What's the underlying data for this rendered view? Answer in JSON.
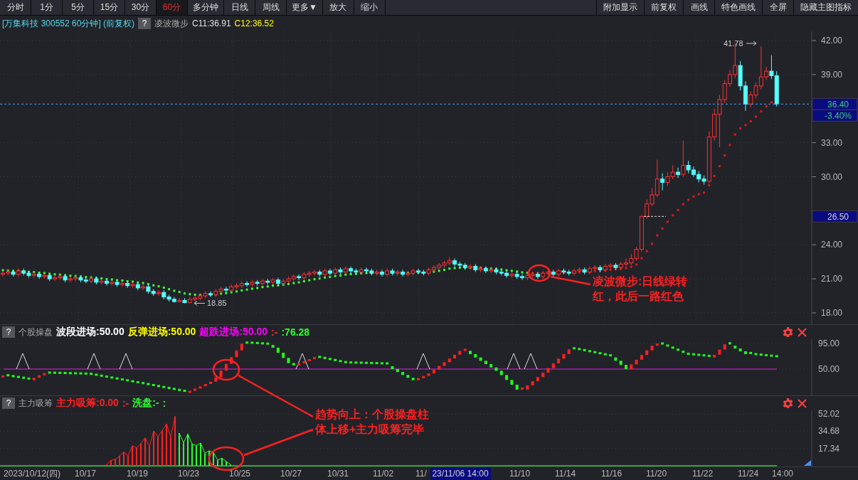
{
  "toolbar": {
    "left": [
      {
        "label": "分时",
        "selected": false
      },
      {
        "label": "1分",
        "selected": false
      },
      {
        "label": "5分",
        "selected": false
      },
      {
        "label": "15分",
        "selected": false
      },
      {
        "label": "30分",
        "selected": false
      },
      {
        "label": "60分",
        "selected": true
      },
      {
        "label": "多分钟",
        "selected": false
      },
      {
        "label": "日线",
        "selected": false
      },
      {
        "label": "周线",
        "selected": false
      },
      {
        "label": "更多▼",
        "selected": false
      },
      {
        "label": "放大",
        "selected": false
      },
      {
        "label": "缩小",
        "selected": false
      }
    ],
    "right": [
      "附加显示",
      "前复权",
      "画线",
      "特色画线",
      "全屏",
      "隐藏主图指标"
    ]
  },
  "info": {
    "title": "[万集科技 300552 60分钟] (前复权)",
    "help": "?",
    "indicator": "凌波微步",
    "values": [
      {
        "text": "C11:36.91",
        "color": "#e0e0e0"
      },
      {
        "text": "C12:36.52",
        "color": "#ffff00"
      }
    ]
  },
  "main_chart": {
    "chart_data": {
      "type": "candlestick",
      "ylim": [
        18,
        42
      ],
      "grid": true,
      "yticks": [
        {
          "value": 42,
          "label": "42.00"
        },
        {
          "value": 39,
          "label": "39.00"
        },
        {
          "value": 33,
          "label": "33.00"
        },
        {
          "value": 30,
          "label": "30.00"
        },
        {
          "value": 24,
          "label": "24.00"
        },
        {
          "value": 21,
          "label": "21.00"
        },
        {
          "value": 18,
          "label": "18.00"
        }
      ],
      "ohlc": [
        [
          21.4,
          21.7,
          21.2,
          21.5
        ],
        [
          21.5,
          21.8,
          21.3,
          21.6
        ],
        [
          21.6,
          21.8,
          21.2,
          21.4
        ],
        [
          21.4,
          21.9,
          21.2,
          21.7
        ],
        [
          21.7,
          21.9,
          21.3,
          21.5
        ],
        [
          21.5,
          21.7,
          21.1,
          21.3
        ],
        [
          21.3,
          21.6,
          21.1,
          21.4
        ],
        [
          21.4,
          21.6,
          21.0,
          21.2
        ],
        [
          21.2,
          21.5,
          21.0,
          21.3
        ],
        [
          21.3,
          21.5,
          20.8,
          21.0
        ],
        [
          21.0,
          21.3,
          20.8,
          21.1
        ],
        [
          21.1,
          21.4,
          20.9,
          21.2
        ],
        [
          21.2,
          21.4,
          20.7,
          20.9
        ],
        [
          20.9,
          21.2,
          20.7,
          21.0
        ],
        [
          21.0,
          21.3,
          20.8,
          21.1
        ],
        [
          21.1,
          21.3,
          20.7,
          20.9
        ],
        [
          20.9,
          21.1,
          20.6,
          20.8
        ],
        [
          20.8,
          21.2,
          20.6,
          21.0
        ],
        [
          21.0,
          21.2,
          20.5,
          20.7
        ],
        [
          20.7,
          21.0,
          20.5,
          20.8
        ],
        [
          20.8,
          21.0,
          20.4,
          20.6
        ],
        [
          20.6,
          20.9,
          20.4,
          20.7
        ],
        [
          20.7,
          20.9,
          20.3,
          20.5
        ],
        [
          20.5,
          20.8,
          20.3,
          20.6
        ],
        [
          20.6,
          20.8,
          20.2,
          20.4
        ],
        [
          20.4,
          20.7,
          20.2,
          20.5
        ],
        [
          20.5,
          20.7,
          20.0,
          20.2
        ],
        [
          20.2,
          20.5,
          20.0,
          20.3
        ],
        [
          20.3,
          20.5,
          19.7,
          19.9
        ],
        [
          19.9,
          20.1,
          19.5,
          19.7
        ],
        [
          19.7,
          20.0,
          19.5,
          19.8
        ],
        [
          19.8,
          20.0,
          19.2,
          19.4
        ],
        [
          19.4,
          19.6,
          19.0,
          19.2
        ],
        [
          19.2,
          19.4,
          18.9,
          19.0
        ],
        [
          19.0,
          19.3,
          18.9,
          19.1
        ],
        [
          19.1,
          19.3,
          18.85,
          18.9
        ],
        [
          18.9,
          19.4,
          18.9,
          19.2
        ],
        [
          19.2,
          19.5,
          19.0,
          19.3
        ],
        [
          19.3,
          19.7,
          19.1,
          19.5
        ],
        [
          19.5,
          19.9,
          19.3,
          19.7
        ],
        [
          19.7,
          19.9,
          19.4,
          19.6
        ],
        [
          19.6,
          20.1,
          19.4,
          19.9
        ],
        [
          19.9,
          20.3,
          19.7,
          20.1
        ],
        [
          20.1,
          20.3,
          19.8,
          20.0
        ],
        [
          20.0,
          20.5,
          19.8,
          20.3
        ],
        [
          20.3,
          20.6,
          20.1,
          20.4
        ],
        [
          20.4,
          20.8,
          20.2,
          20.6
        ],
        [
          20.6,
          20.8,
          20.3,
          20.5
        ],
        [
          20.5,
          20.9,
          20.3,
          20.7
        ],
        [
          20.7,
          20.9,
          20.4,
          20.6
        ],
        [
          20.6,
          21.0,
          20.4,
          20.8
        ],
        [
          20.8,
          21.0,
          20.5,
          20.7
        ],
        [
          20.7,
          21.1,
          20.5,
          20.9
        ],
        [
          20.9,
          21.1,
          20.4,
          20.6
        ],
        [
          20.6,
          21.0,
          20.4,
          20.8
        ],
        [
          20.8,
          21.2,
          20.6,
          21.0
        ],
        [
          21.0,
          21.4,
          20.8,
          21.2
        ],
        [
          21.2,
          21.4,
          20.9,
          21.1
        ],
        [
          21.1,
          21.6,
          20.9,
          21.4
        ],
        [
          21.4,
          21.7,
          21.2,
          21.5
        ],
        [
          21.5,
          21.8,
          21.3,
          21.6
        ],
        [
          21.6,
          21.8,
          21.2,
          21.4
        ],
        [
          21.4,
          21.9,
          21.2,
          21.7
        ],
        [
          21.7,
          21.9,
          21.3,
          21.5
        ],
        [
          21.5,
          22.0,
          21.3,
          21.8
        ],
        [
          21.8,
          22.0,
          21.4,
          21.6
        ],
        [
          21.6,
          22.1,
          21.4,
          21.9
        ],
        [
          21.9,
          22.1,
          21.5,
          21.7
        ],
        [
          21.7,
          21.9,
          21.4,
          21.6
        ],
        [
          21.6,
          22.0,
          21.4,
          21.8
        ],
        [
          21.8,
          22.0,
          21.5,
          21.7
        ],
        [
          21.7,
          21.9,
          21.3,
          21.5
        ],
        [
          21.5,
          21.8,
          21.3,
          21.6
        ],
        [
          21.6,
          21.8,
          21.2,
          21.4
        ],
        [
          21.4,
          21.9,
          21.2,
          21.7
        ],
        [
          21.7,
          21.9,
          21.3,
          21.5
        ],
        [
          21.5,
          21.8,
          21.3,
          21.6
        ],
        [
          21.6,
          21.8,
          21.2,
          21.4
        ],
        [
          21.4,
          21.7,
          21.2,
          21.5
        ],
        [
          21.5,
          21.9,
          21.3,
          21.7
        ],
        [
          21.7,
          21.9,
          21.4,
          21.6
        ],
        [
          21.6,
          21.8,
          21.3,
          21.5
        ],
        [
          21.5,
          22.0,
          21.3,
          21.8
        ],
        [
          21.8,
          22.2,
          21.6,
          22.0
        ],
        [
          22.0,
          22.4,
          21.8,
          22.2
        ],
        [
          22.2,
          22.6,
          22.0,
          22.4
        ],
        [
          22.4,
          22.9,
          22.2,
          22.6
        ],
        [
          22.6,
          22.8,
          22.1,
          22.3
        ],
        [
          22.3,
          22.5,
          22.0,
          22.2
        ],
        [
          22.2,
          22.4,
          21.8,
          22.0
        ],
        [
          22.0,
          22.3,
          21.8,
          22.1
        ],
        [
          22.1,
          22.3,
          21.6,
          21.8
        ],
        [
          21.8,
          22.1,
          21.6,
          21.9
        ],
        [
          21.9,
          22.1,
          21.5,
          21.7
        ],
        [
          21.7,
          22.0,
          21.5,
          21.8
        ],
        [
          21.8,
          22.0,
          21.4,
          21.6
        ],
        [
          21.6,
          21.8,
          21.3,
          21.5
        ],
        [
          21.5,
          21.7,
          21.1,
          21.3
        ],
        [
          21.3,
          21.6,
          21.1,
          21.4
        ],
        [
          21.4,
          21.6,
          21.0,
          21.2
        ],
        [
          21.2,
          21.4,
          20.9,
          21.1
        ],
        [
          21.1,
          21.5,
          20.9,
          21.3
        ],
        [
          21.3,
          21.6,
          21.1,
          21.4
        ],
        [
          21.4,
          21.6,
          21.0,
          21.2
        ],
        [
          21.2,
          21.7,
          21.0,
          21.5
        ],
        [
          21.5,
          21.8,
          21.3,
          21.6
        ],
        [
          21.6,
          21.8,
          21.2,
          21.4
        ],
        [
          21.4,
          21.9,
          21.2,
          21.7
        ],
        [
          21.7,
          21.9,
          21.4,
          21.6
        ],
        [
          21.6,
          21.8,
          21.3,
          21.5
        ],
        [
          21.5,
          21.9,
          21.3,
          21.7
        ],
        [
          21.7,
          22.0,
          21.5,
          21.8
        ],
        [
          21.8,
          22.0,
          21.4,
          21.6
        ],
        [
          21.6,
          22.1,
          21.4,
          21.9
        ],
        [
          21.9,
          22.2,
          21.7,
          22.0
        ],
        [
          22.0,
          22.2,
          21.6,
          21.8
        ],
        [
          21.8,
          22.3,
          21.6,
          22.1
        ],
        [
          22.1,
          22.4,
          21.9,
          22.2
        ],
        [
          22.2,
          22.4,
          21.8,
          22.0
        ],
        [
          22.0,
          22.5,
          21.8,
          22.3
        ],
        [
          22.3,
          22.8,
          22.1,
          22.4
        ],
        [
          22.4,
          23.2,
          22.2,
          22.8
        ],
        [
          22.8,
          23.8,
          22.6,
          23.6
        ],
        [
          23.6,
          26.6,
          23.4,
          26.5
        ],
        [
          26.5,
          28.0,
          26.3,
          27.6
        ],
        [
          27.6,
          29.0,
          27.4,
          28.4
        ],
        [
          28.4,
          31.5,
          28.2,
          29.8
        ],
        [
          29.8,
          30.3,
          28.8,
          29.5
        ],
        [
          29.5,
          30.4,
          29.2,
          30.0
        ],
        [
          30.0,
          31.0,
          29.8,
          30.4
        ],
        [
          30.4,
          30.8,
          29.9,
          30.2
        ],
        [
          30.2,
          33.2,
          30.0,
          31.0
        ],
        [
          31.0,
          31.4,
          30.3,
          30.6
        ],
        [
          30.6,
          30.9,
          30.0,
          30.2
        ],
        [
          30.2,
          30.5,
          29.5,
          29.8
        ],
        [
          29.8,
          30.1,
          29.3,
          29.6
        ],
        [
          29.6,
          34.0,
          29.4,
          33.5
        ],
        [
          33.5,
          36.0,
          33.2,
          35.5
        ],
        [
          35.5,
          37.2,
          32.6,
          36.8
        ],
        [
          36.8,
          38.5,
          36.5,
          38.2
        ],
        [
          38.2,
          39.4,
          37.9,
          39.0
        ],
        [
          39.0,
          41.78,
          38.7,
          39.8
        ],
        [
          39.8,
          40.2,
          37.6,
          38.0
        ],
        [
          38.0,
          38.4,
          35.8,
          36.4
        ],
        [
          36.4,
          37.5,
          36.1,
          37.2
        ],
        [
          37.2,
          38.3,
          36.9,
          38.0
        ],
        [
          38.0,
          41.5,
          37.7,
          38.8
        ],
        [
          38.8,
          39.7,
          38.5,
          39.3
        ],
        [
          39.3,
          40.7,
          38.6,
          38.9
        ],
        [
          38.9,
          39.3,
          36.2,
          36.4
        ]
      ]
    },
    "price_tags": [
      {
        "kind": "last",
        "text": "36.40"
      },
      {
        "kind": "change",
        "text": "-3.40%"
      },
      {
        "kind": "level",
        "text": "26.50"
      }
    ],
    "high_label": "41.78",
    "low_label": "18.85"
  },
  "indicators": [
    {
      "help": "?",
      "name": "个股操盘",
      "values": [
        {
          "text": "波段进场:50.00",
          "color": "#ffffff"
        },
        {
          "text": "反弹进场:50.00",
          "color": "#ffff00"
        },
        {
          "text": "超跌进场:50.00",
          "color": "#ff00ff"
        },
        {
          "text": ":-",
          "color": "#ff3030"
        },
        {
          "text": ":76.28",
          "color": "#30ff30"
        }
      ],
      "axis": [
        "95.00",
        "50.00"
      ]
    },
    {
      "help": "?",
      "name": "主力吸筹",
      "values": [
        {
          "text": "主力吸筹:0.00",
          "color": "#ff2020"
        },
        {
          "text": ":-",
          "color": "#ff3030"
        },
        {
          "text": "洗盘:-",
          "color": "#30ff30"
        },
        {
          "text": ":",
          "color": "#30ff30"
        }
      ],
      "axis": [
        "52.02",
        "34.68",
        "17.34"
      ]
    }
  ],
  "annotations": [
    {
      "lines": [
        "凌波微步:日线绿转",
        "红，此后一路红色"
      ]
    },
    {
      "lines": [
        "趋势向上：个股操盘柱",
        "体上移+主力吸筹完毕"
      ]
    }
  ],
  "x_axis": {
    "labels": [
      "2023/10/12(四)",
      "10/17",
      "10/19",
      "10/23",
      "10/25",
      "10/27",
      "10/31",
      "11/02",
      "11/",
      "11/10",
      "11/14",
      "11/16",
      "11/20",
      "11/22",
      "11/24",
      "14:00"
    ],
    "cursor_label": "23/11/06 14:00"
  }
}
